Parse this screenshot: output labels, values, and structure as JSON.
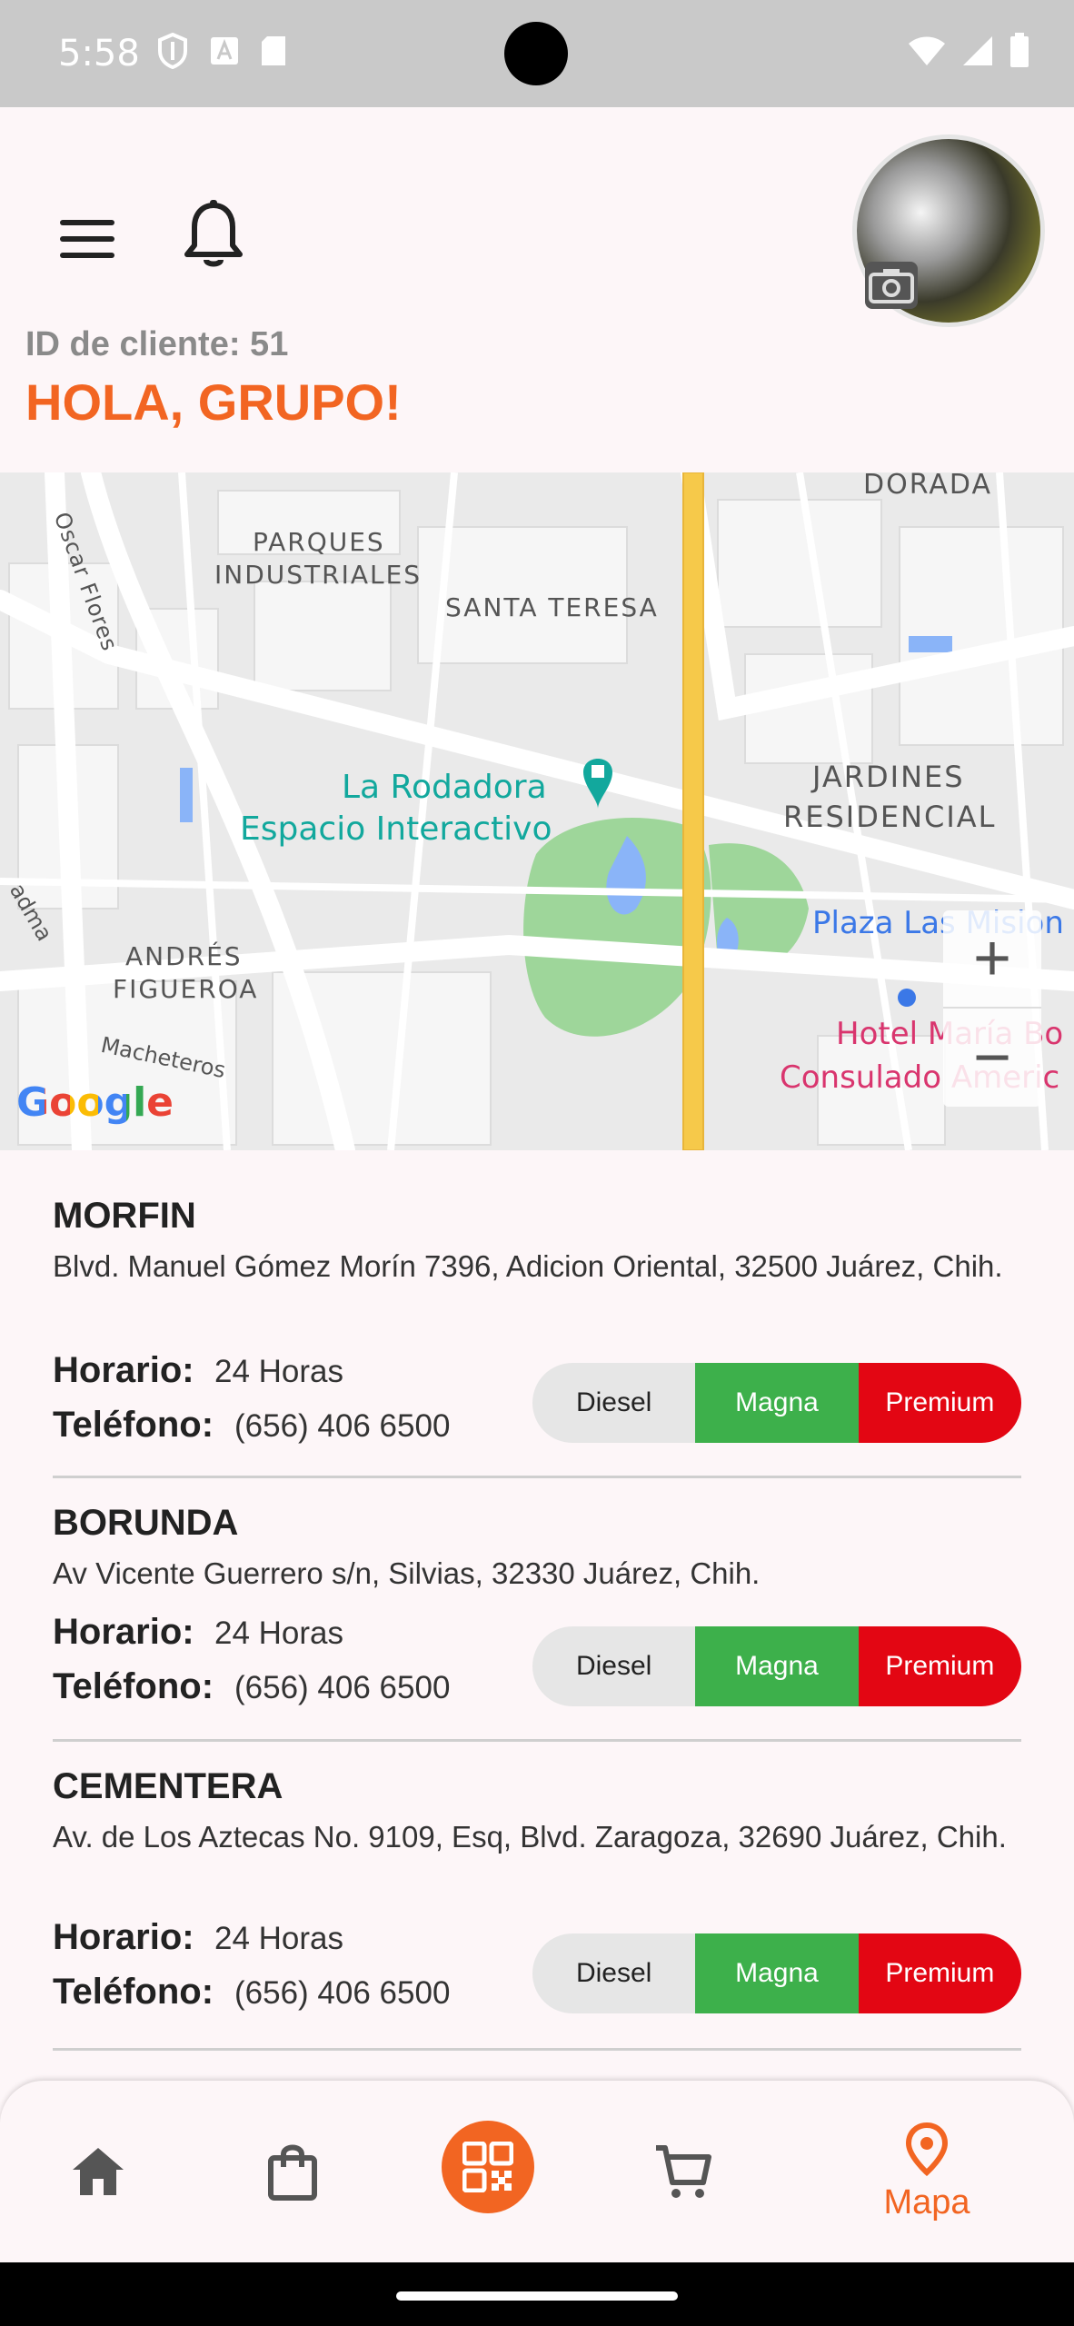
{
  "status_bar": {
    "time": "5:58"
  },
  "header": {
    "client_id": "ID de cliente: 51",
    "greeting": "HOLA, GRUPO!"
  },
  "map": {
    "labels": {
      "dorada": "DORADA",
      "oscar_flores": "Oscar Flores",
      "parques": "PARQUES",
      "industriales": "INDUSTRIALES",
      "santa_teresa": "SANTA TERESA",
      "la_rodadora_1": "La Rodadora",
      "la_rodadora_2": "Espacio Interactivo",
      "jardines": "JARDINES",
      "residencial": "RESIDENCIAL",
      "plaza": "Plaza Las Mision",
      "hotel": "Hotel María Bo",
      "consulado": "Consulado Americ",
      "andres": "ANDRÉS",
      "figueroa": "FIGUEROA",
      "macheteros": "Macheteros",
      "adma": "adma"
    },
    "zoom_in": "+",
    "zoom_out": "−",
    "attribution": "Google"
  },
  "stations": [
    {
      "name": "MORFIN",
      "address": "Blvd. Manuel Gómez Morín 7396, Adicion Oriental, 32500 Juárez, Chih.",
      "horario_label": "Horario:",
      "horario": "24 Horas",
      "telefono_label": "Teléfono:",
      "telefono": "(656) 406 6500",
      "fuels": [
        "Diesel",
        "Magna",
        "Premium"
      ]
    },
    {
      "name": "BORUNDA",
      "address": "Av Vicente Guerrero s/n, Silvias, 32330 Juárez, Chih.",
      "horario_label": "Horario:",
      "horario": "24 Horas",
      "telefono_label": "Teléfono:",
      "telefono": "(656) 406 6500",
      "fuels": [
        "Diesel",
        "Magna",
        "Premium"
      ]
    },
    {
      "name": "CEMENTERA",
      "address": "Av. de Los Aztecas No. 9109, Esq, Blvd. Zaragoza, 32690 Juárez, Chih.",
      "horario_label": "Horario:",
      "horario": "24 Horas",
      "telefono_label": "Teléfono:",
      "telefono": "(656) 406 6500",
      "fuels": [
        "Diesel",
        "Magna",
        "Premium"
      ]
    }
  ],
  "bottom_nav": {
    "active_label": "Mapa"
  },
  "colors": {
    "accent": "#f26522",
    "magna": "#3db04b",
    "premium": "#e30613",
    "diesel": "#e6e6e6"
  }
}
